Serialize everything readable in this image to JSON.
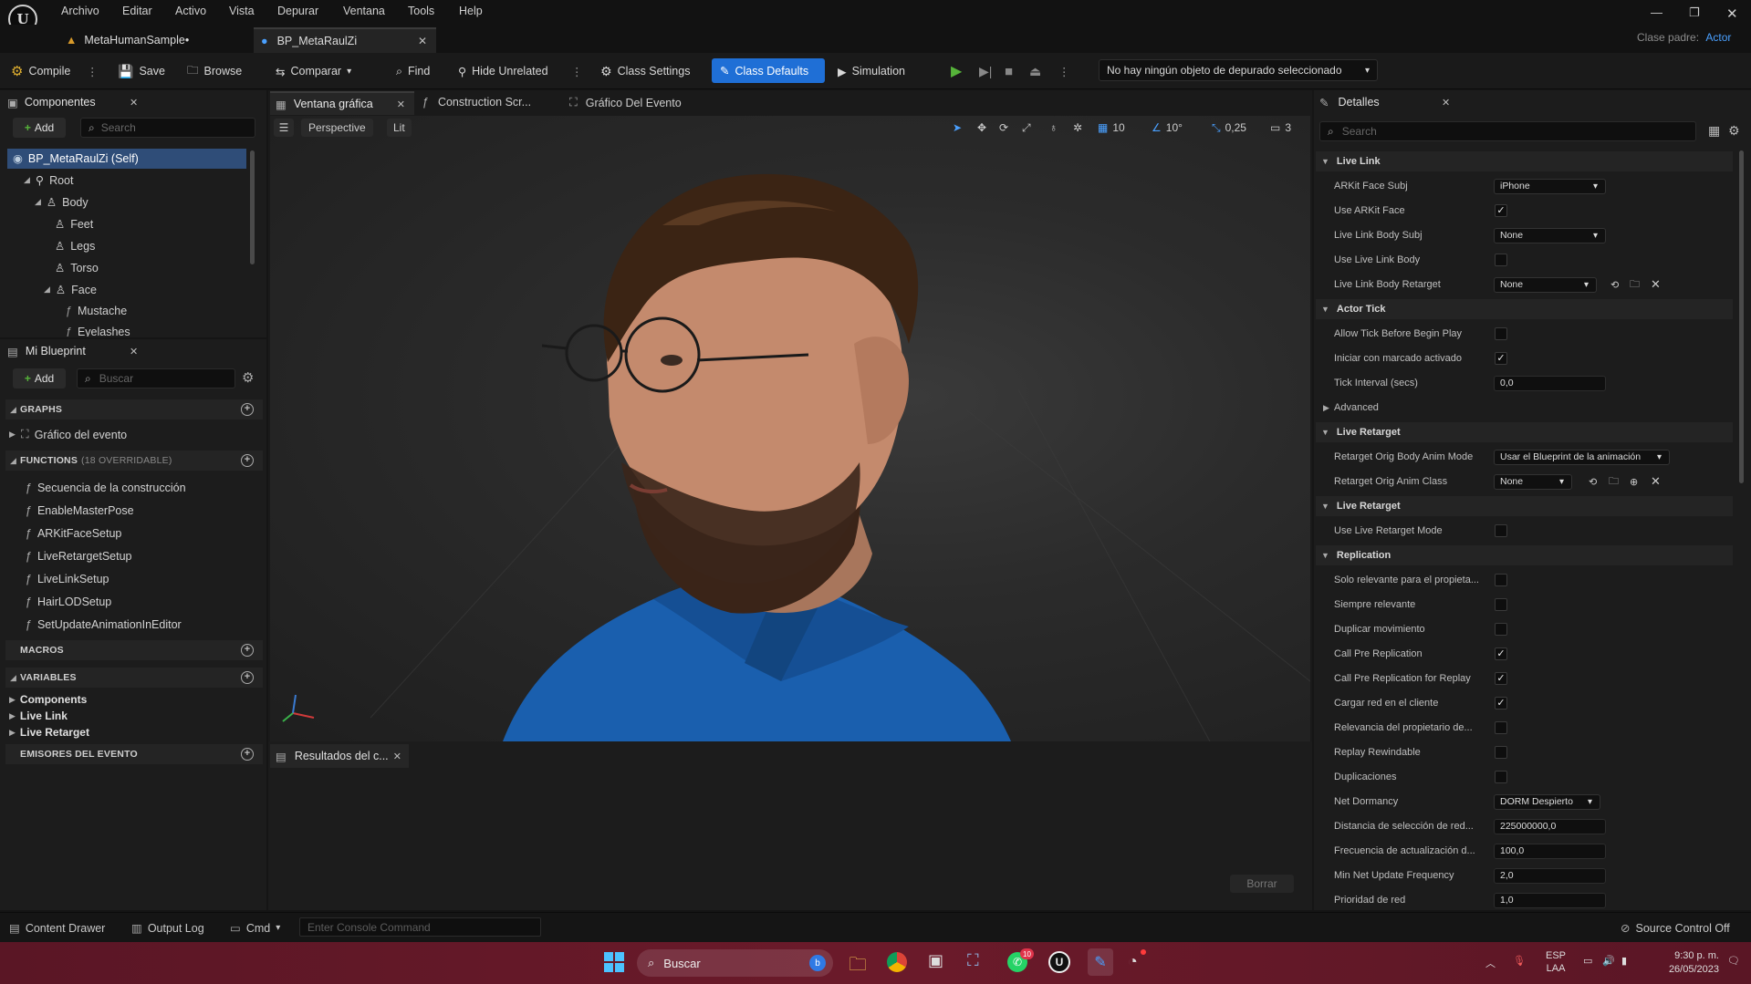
{
  "menubar": {
    "items": [
      "Archivo",
      "Editar",
      "Activo",
      "Vista",
      "Depurar",
      "Ventana",
      "Tools",
      "Help"
    ]
  },
  "tabs": {
    "doc1": "MetaHumanSample•",
    "doc2": "BP_MetaRaulZi",
    "parent_label": "Clase padre:",
    "parent_value": "Actor"
  },
  "toolbar": {
    "compile": "Compile",
    "save": "Save",
    "browse": "Browse",
    "compare": "Comparar",
    "find": "Find",
    "hide_unrelated": "Hide Unrelated",
    "class_settings": "Class Settings",
    "class_defaults": "Class Defaults",
    "simulation": "Simulation",
    "debug_object": "No hay ningún objeto de depurado seleccionado"
  },
  "components": {
    "title": "Componentes",
    "add": "Add",
    "search_placeholder": "Search",
    "tree": [
      "BP_MetaRaulZi (Self)",
      "Root",
      "Body",
      "Feet",
      "Legs",
      "Torso",
      "Face",
      "Mustache",
      "Eyelashes"
    ]
  },
  "blueprint": {
    "title": "Mi Blueprint",
    "add": "Add",
    "search_placeholder": "Buscar",
    "graphs_label": "GRAPHS",
    "graph_item": "Gráfico del evento",
    "functions_label": "FUNCTIONS",
    "functions_count": "(18 OVERRIDABLE)",
    "functions": [
      "Secuencia de la construcción",
      "EnableMasterPose",
      "ARKitFaceSetup",
      "LiveRetargetSetup",
      "LiveLinkSetup",
      "HairLODSetup",
      "SetUpdateAnimationInEditor"
    ],
    "macros_label": "MACROS",
    "variables_label": "VARIABLES",
    "variables": [
      "Components",
      "Live Link",
      "Live Retarget"
    ],
    "dispatchers_label": "EMISORES DEL EVENTO"
  },
  "viewport": {
    "tab1": "Ventana gráfica",
    "tab2": "Construction Scr...",
    "tab3": "Gráfico Del Evento",
    "perspective": "Perspective",
    "lit": "Lit",
    "grid_snap": "10",
    "rot_snap": "10°",
    "scale_snap": "0,25",
    "cam_speed": "3"
  },
  "results": {
    "tab": "Resultados del c...",
    "clear": "Borrar"
  },
  "details": {
    "title": "Detalles",
    "search_placeholder": "Search",
    "cat_livelink": "Live Link",
    "arkit_face_subj": "ARKit Face Subj",
    "arkit_face_subj_val": "iPhone",
    "use_arkit_face": "Use ARKit Face",
    "livelink_body_subj": "Live Link Body Subj",
    "livelink_body_subj_val": "None",
    "use_livelink_body": "Use Live Link Body",
    "livelink_body_retarget": "Live Link Body Retarget",
    "livelink_body_retarget_val": "None",
    "cat_actortick": "Actor Tick",
    "allow_tick": "Allow Tick Before Begin Play",
    "start_enabled": "Iniciar con marcado activado",
    "tick_interval": "Tick Interval (secs)",
    "tick_interval_val": "0,0",
    "advanced": "Advanced",
    "cat_liveretarget1": "Live Retarget",
    "retarget_body_mode": "Retarget Orig Body Anim Mode",
    "retarget_body_mode_val": "Usar el Blueprint de la animación",
    "retarget_anim_class": "Retarget Orig Anim Class",
    "retarget_anim_class_val": "None",
    "cat_liveretarget2": "Live Retarget",
    "use_live_retarget": "Use Live Retarget Mode",
    "cat_replication": "Replication",
    "solo_relevante": "Solo relevante para el propieta...",
    "siempre_relevante": "Siempre relevante",
    "duplicar_mov": "Duplicar movimiento",
    "call_pre_rep": "Call Pre Replication",
    "call_pre_rep_replay": "Call Pre Replication for Replay",
    "cargar_red": "Cargar red en el cliente",
    "relevancia_prop": "Relevancia del propietario de...",
    "replay_rewindable": "Replay Rewindable",
    "duplicaciones": "Duplicaciones",
    "net_dormancy": "Net Dormancy",
    "net_dormancy_val": "DORM Despierto",
    "distancia_sel": "Distancia de selección de red...",
    "distancia_sel_val": "225000000,0",
    "frecuencia_act": "Frecuencia de actualización d...",
    "frecuencia_act_val": "100,0",
    "min_net_update": "Min Net Update Frequency",
    "min_net_update_val": "2,0",
    "prioridad_red": "Prioridad de red",
    "prioridad_red_val": "1,0"
  },
  "statusbar": {
    "content_drawer": "Content Drawer",
    "output_log": "Output Log",
    "cmd": "Cmd",
    "console_placeholder": "Enter Console Command",
    "source_control": "Source Control Off"
  },
  "taskbar": {
    "search": "Buscar",
    "lang1": "ESP",
    "lang2": "LAA",
    "time": "9:30 p. m.",
    "date": "26/05/2023",
    "whatsapp_badge": "10"
  },
  "colors": {
    "accent": "#1f6fd6",
    "taskbar": "#6b1a2a",
    "play_green": "#56b43a",
    "shirt_blue": "#1a5fae"
  }
}
